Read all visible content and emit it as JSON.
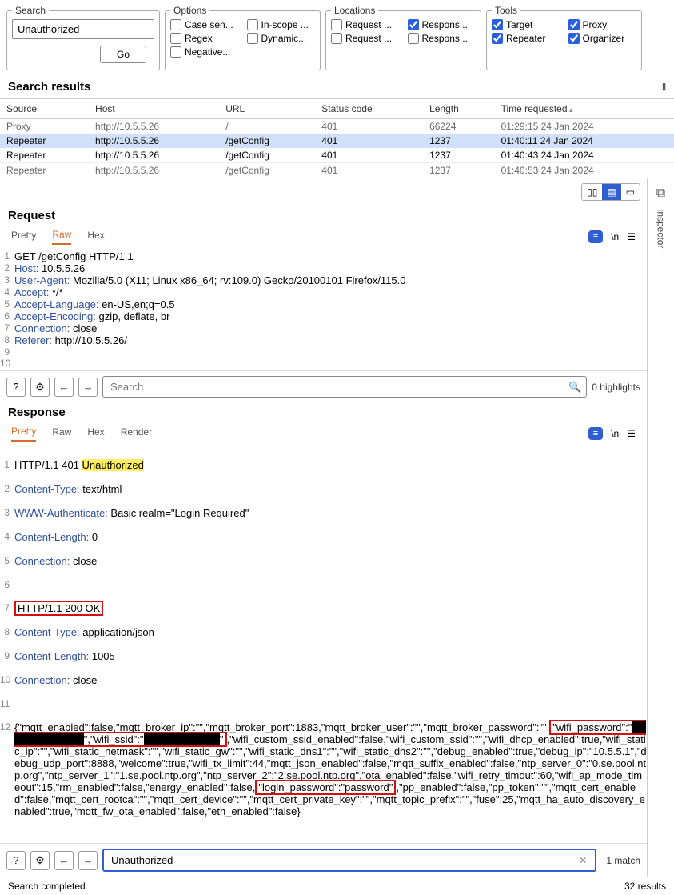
{
  "search": {
    "legend": "Search",
    "value": "Unauthorized",
    "go": "Go"
  },
  "options": {
    "legend": "Options",
    "items": [
      {
        "label": "Case sen...",
        "checked": false
      },
      {
        "label": "In-scope ...",
        "checked": false
      },
      {
        "label": "Regex",
        "checked": false
      },
      {
        "label": "Dynamic...",
        "checked": false
      },
      {
        "label": "Negative...",
        "checked": false
      }
    ]
  },
  "locations": {
    "legend": "Locations",
    "items": [
      {
        "label": "Request ...",
        "checked": false
      },
      {
        "label": "Respons...",
        "checked": true
      },
      {
        "label": "Request ...",
        "checked": false
      },
      {
        "label": "Respons...",
        "checked": false
      }
    ]
  },
  "tools": {
    "legend": "Tools",
    "items": [
      {
        "label": "Target",
        "checked": true
      },
      {
        "label": "Proxy",
        "checked": true
      },
      {
        "label": "Repeater",
        "checked": true
      },
      {
        "label": "Organizer",
        "checked": true
      }
    ]
  },
  "results_title": "Search results",
  "columns": [
    "Source",
    "Host",
    "URL",
    "Status code",
    "Length",
    "Time requested"
  ],
  "rows": [
    {
      "source": "Proxy",
      "host": "http://10.5.5.26",
      "url": "/",
      "status": "401",
      "length": "66224",
      "time": "01:29:15 24 Jan 2024",
      "cut_top": true
    },
    {
      "source": "Repeater",
      "host": "http://10.5.5.26",
      "url": "/getConfig",
      "status": "401",
      "length": "1237",
      "time": "01:40:11 24 Jan 2024",
      "selected": true
    },
    {
      "source": "Repeater",
      "host": "http://10.5.5.26",
      "url": "/getConfig",
      "status": "401",
      "length": "1237",
      "time": "01:40:43 24 Jan 2024"
    },
    {
      "source": "Repeater",
      "host": "http://10.5.5.26",
      "url": "/getConfig",
      "status": "401",
      "length": "1237",
      "time": "01:40:53 24 Jan 2024",
      "cut_bottom": true
    }
  ],
  "request": {
    "title": "Request",
    "tabs": [
      "Pretty",
      "Raw",
      "Hex"
    ],
    "active_tab": "Raw",
    "badge": "≡",
    "newline": "\\n",
    "lines": [
      {
        "n": "1",
        "t": "GET /getConfig HTTP/1.1"
      },
      {
        "n": "2",
        "h": "Host:",
        "v": " 10.5.5.26"
      },
      {
        "n": "3",
        "h": "User-Agent:",
        "v": " Mozilla/5.0 (X11; Linux x86_64; rv:109.0) Gecko/20100101 Firefox/115.0"
      },
      {
        "n": "4",
        "h": "Accept:",
        "v": " */*"
      },
      {
        "n": "5",
        "h": "Accept-Language:",
        "v": " en-US,en;q=0.5"
      },
      {
        "n": "6",
        "h": "Accept-Encoding:",
        "v": " gzip, deflate, br"
      },
      {
        "n": "7",
        "h": "Connection:",
        "v": " close"
      },
      {
        "n": "8",
        "h": "Referer:",
        "v": " http://10.5.5.26/"
      },
      {
        "n": "9",
        "t": ""
      },
      {
        "n": "10",
        "t": ""
      }
    ],
    "search_placeholder": "Search",
    "highlights_label": "0 highlights"
  },
  "response": {
    "title": "Response",
    "tabs": [
      "Pretty",
      "Raw",
      "Hex",
      "Render"
    ],
    "active_tab": "Pretty",
    "search_value": "Unauthorized",
    "match_label": "1 match"
  },
  "status": {
    "left": "Search completed",
    "right": "32 results"
  },
  "inspector_label": "Inspector"
}
